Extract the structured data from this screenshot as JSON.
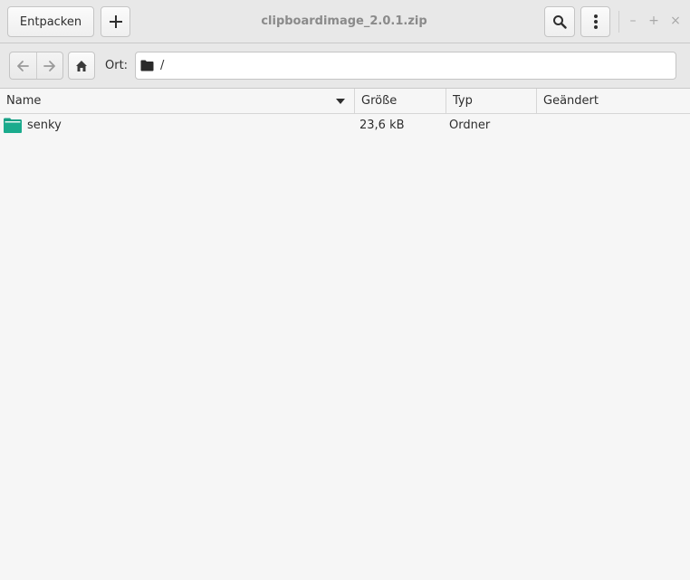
{
  "window": {
    "title": "clipboardimage_2.0.1.zip"
  },
  "toolbar": {
    "extract_label": "Entpacken",
    "add_icon": "plus-icon",
    "search_icon": "search-icon",
    "menu_icon": "vertical-dots-icon"
  },
  "window_controls": {
    "minimize": "–",
    "maximize": "+",
    "close": "×"
  },
  "location": {
    "label": "Ort:",
    "path": "/",
    "back_icon": "arrow-left-icon",
    "forward_icon": "arrow-right-icon",
    "home_icon": "home-icon",
    "folder_icon": "folder-icon"
  },
  "columns": {
    "name": "Name",
    "size": "Größe",
    "type": "Typ",
    "modified": "Geändert"
  },
  "files": [
    {
      "name": "senky",
      "size": "23,6 kB",
      "type": "Ordner",
      "modified": "",
      "icon": "folder-icon",
      "icon_color": "#16a085"
    }
  ],
  "colors": {
    "folder_accent": "#16a085",
    "header_bg": "#e8e8e8",
    "content_bg": "#f6f6f6"
  }
}
